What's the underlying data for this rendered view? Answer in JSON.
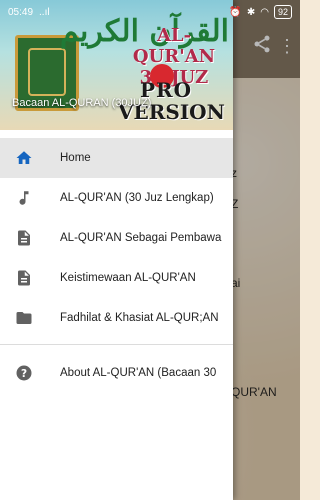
{
  "status_bar": {
    "time": "05:49",
    "signal": "..ıl",
    "battery": "92"
  },
  "header": {
    "calligraphy": "القرآن الكريم",
    "title_line1": "AL-QUR'AN",
    "title_line2": "30 JUZ",
    "badge_line1": "PRO",
    "badge_line2": "VERSION",
    "subtitle": "Bacaan AL-QURAN (30JUZ)"
  },
  "menu": {
    "items": [
      {
        "label": "Home",
        "icon": "home-icon"
      },
      {
        "label": "AL-QUR'AN (30 Juz Lengkap)",
        "icon": "music-note-icon"
      },
      {
        "label": "AL-QUR'AN Sebagai Pembawa",
        "icon": "document-icon"
      },
      {
        "label": "Keistimewaan AL-QUR'AN",
        "icon": "document-icon"
      },
      {
        "label": "Fadhilat & Khasiat AL-QUR;AN",
        "icon": "folder-icon"
      },
      {
        "label": "About AL-QUR'AN (Bacaan 30",
        "icon": "help-icon"
      }
    ]
  },
  "background": {
    "text_z1": "z",
    "text_z2": "Z",
    "text_ai": "ai",
    "text_quran": "QUR'AN"
  },
  "colors": {
    "accent": "#1565c0",
    "icon": "#616161",
    "active_bg": "#e6e6e6"
  }
}
